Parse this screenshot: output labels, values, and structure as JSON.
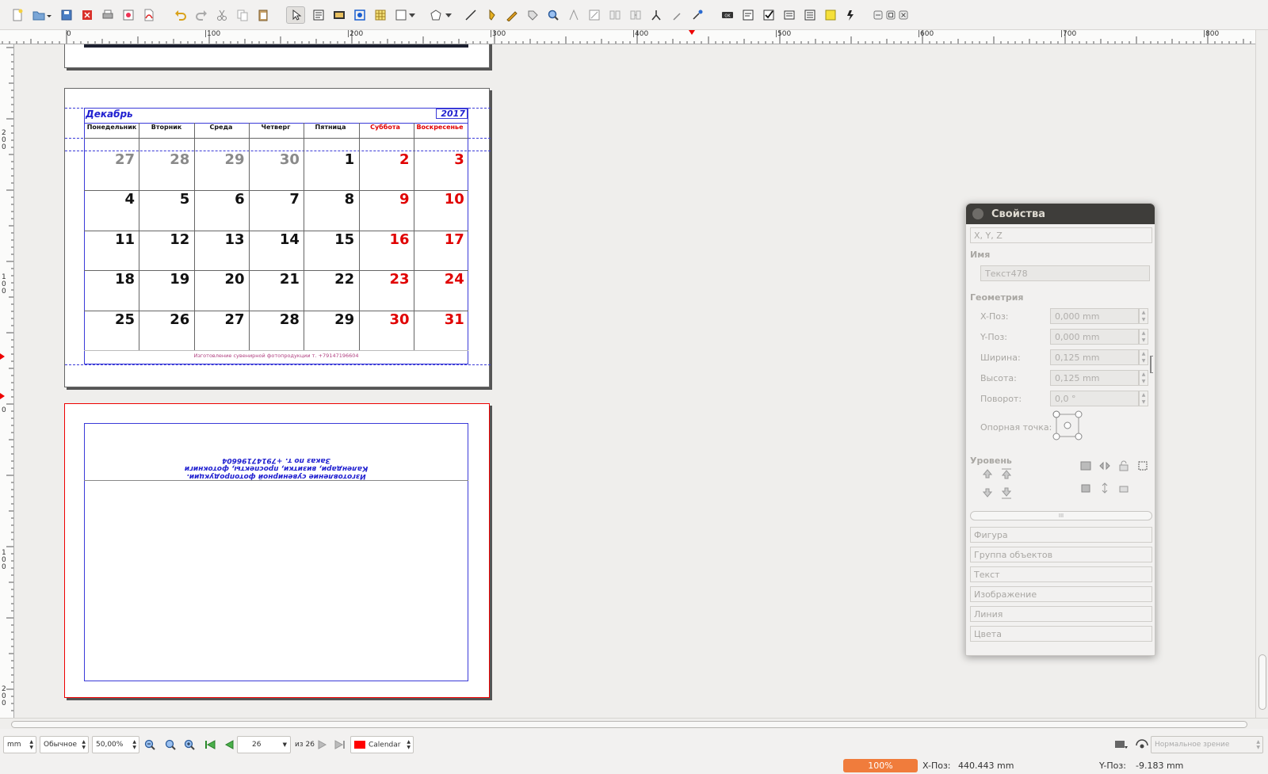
{
  "toolbar": {
    "icons": [
      "new-document",
      "open-document",
      "save",
      "close-document",
      "print",
      "preflight",
      "export-pdf",
      "undo",
      "redo",
      "cut",
      "copy",
      "paste",
      "select",
      "text-frame",
      "image-frame",
      "render-frame",
      "table",
      "shape",
      "polygon",
      "line",
      "bezier-curve",
      "freehand-line",
      "rotate",
      "zoom",
      "edit-contents",
      "link-text-frames",
      "unlink-text-frames",
      "measurements",
      "copy-properties",
      "eyedropper",
      "pdf-push-button",
      "pdf-text-field",
      "pdf-checkbox",
      "pdf-combo-box",
      "pdf-list-box",
      "pdf-text-annotation",
      "pdf-link-annotation",
      "window-minimize",
      "window-restore",
      "window-close"
    ]
  },
  "rulers": {
    "h_labels": [
      "0",
      "|100",
      "|200",
      "|300",
      "|400",
      "|500",
      "|600",
      "|700",
      "|800"
    ],
    "v_labels": [
      "2\n0\n0",
      "1\n0\n0",
      "0",
      "1\n0\n0",
      "2\n0\n0"
    ]
  },
  "calendar": {
    "month": "Декабрь",
    "year": "2017",
    "weekdays": [
      "Понедельник",
      "Вторник",
      "Среда",
      "Четверг",
      "Пятница",
      "Суббота",
      "Воскресенье"
    ],
    "weeks": [
      [
        "27",
        "28",
        "29",
        "30",
        "1",
        "2",
        "3"
      ],
      [
        "4",
        "5",
        "6",
        "7",
        "8",
        "9",
        "10"
      ],
      [
        "11",
        "12",
        "13",
        "14",
        "15",
        "16",
        "17"
      ],
      [
        "18",
        "19",
        "20",
        "21",
        "22",
        "23",
        "24"
      ],
      [
        "25",
        "26",
        "27",
        "28",
        "29",
        "30",
        "31"
      ]
    ],
    "footer": "Изготовление сувенирной фотопродукции т. +79147196604",
    "colors": {
      "prev_month": "#8a8a8a",
      "weekday": "#111111",
      "weekend": "#e00000",
      "title": "#2020d0",
      "footer": "#b04080"
    }
  },
  "back_page": {
    "line1": "Изготовление сувенирной фотопродукции.",
    "line2": "Календари, визитки, проспекты, фотокниги",
    "line3": "Заказ по т. +79147196604"
  },
  "properties": {
    "title": "Свойства",
    "xyz": "X, Y, Z",
    "name_label": "Имя",
    "name_value": "Текст478",
    "geometry_label": "Геометрия",
    "x_label": "X-Поз:",
    "x_value": "0,000  mm",
    "y_label": "Y-Поз:",
    "y_value": "0,000  mm",
    "w_label": "Ширина:",
    "w_value": "0,125  mm",
    "h_label": "Высота:",
    "h_value": "0,125  mm",
    "rot_label": "Поворот:",
    "rot_value": "0,0 °",
    "basepoint_label": "Опорная точка:",
    "level_label": "Уровень",
    "scroll_mark": "III",
    "sections": [
      "Фигура",
      "Группа объектов",
      "Текст",
      "Изображение",
      "Линия",
      "Цвета"
    ]
  },
  "status": {
    "unit": "mm",
    "mode": "Обычное",
    "zoom": "50,00%",
    "page": "26",
    "of_pages": "из 26",
    "layer": "Calendar",
    "layer_color": "#ff0000",
    "view_mode": "Нормальное зрение",
    "progress": "100%",
    "x_label": "X-Поз:",
    "x_value": "440.443  mm",
    "y_label": "Y-Поз:",
    "y_value": "-9.183  mm"
  }
}
